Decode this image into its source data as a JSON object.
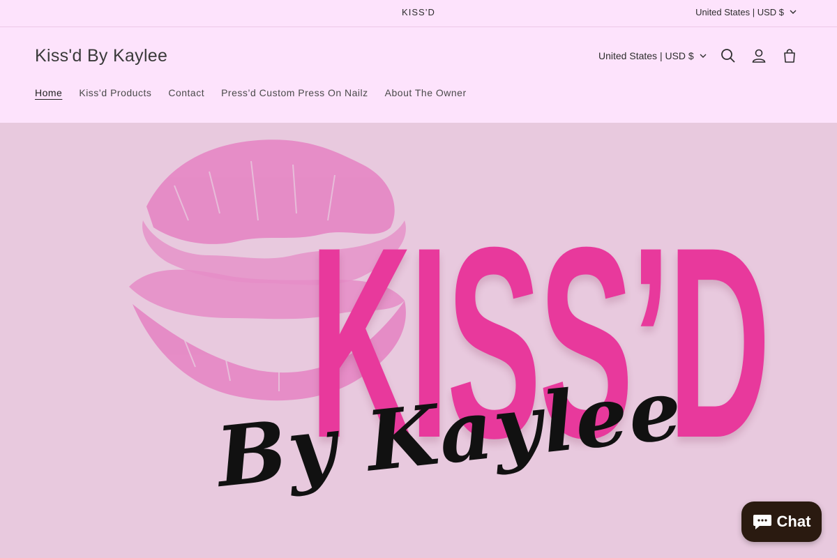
{
  "announcement": {
    "text": "KISS’D"
  },
  "locale_top": {
    "label": "United States | USD $"
  },
  "header": {
    "brand": "Kiss'd By Kaylee",
    "locale": "United States | USD $",
    "icons": [
      "search-icon",
      "account-icon",
      "cart-icon"
    ]
  },
  "nav": {
    "items": [
      {
        "label": "Home",
        "active": true
      },
      {
        "label": "Kiss’d Products"
      },
      {
        "label": "Contact"
      },
      {
        "label": "Press’d Custom Press On Nailz"
      },
      {
        "label": "About The Owner"
      }
    ]
  },
  "hero": {
    "logo_title": "KISS’D",
    "logo_byline": "By Kaylee",
    "colors": {
      "background": "#e8c9de",
      "lips": "#e586c4",
      "title": "#e8399c",
      "byline": "#111111"
    }
  },
  "chat": {
    "label": "Chat"
  },
  "colors": {
    "page_bg": "#fde3fc",
    "text": "#3a3a3a",
    "chat_bg": "#2a1a10"
  }
}
